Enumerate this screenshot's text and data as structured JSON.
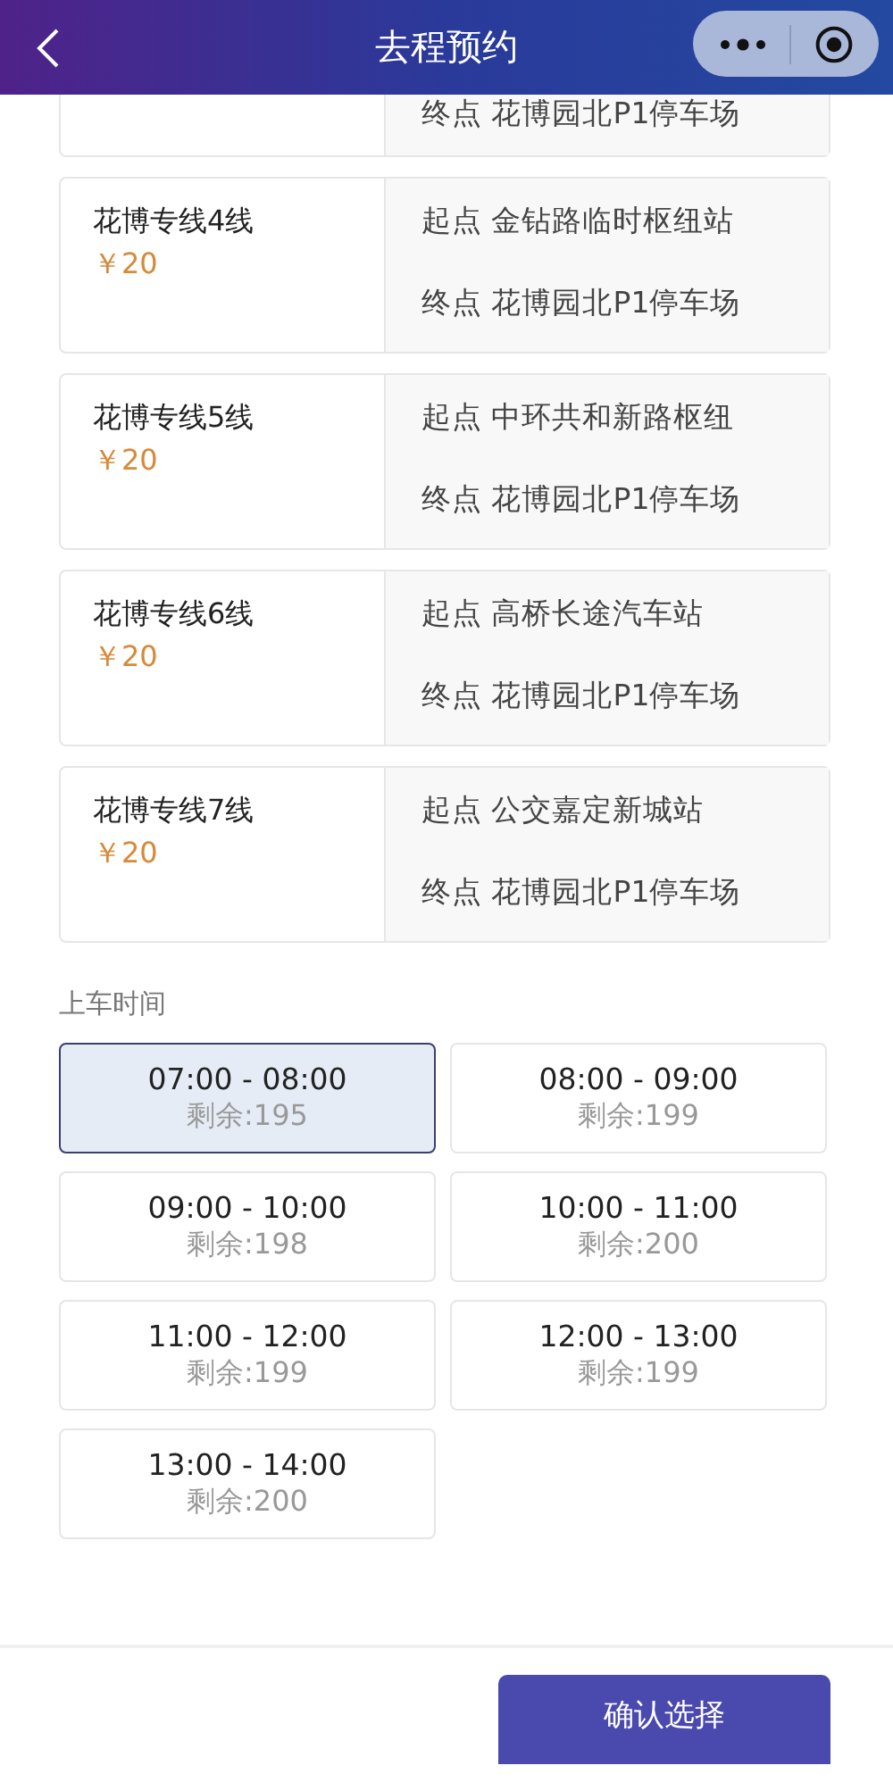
{
  "header": {
    "title": "去程预约"
  },
  "partial_route": {
    "end": "终点 花博园北P1停车场"
  },
  "routes": [
    {
      "name": "花博专线4线",
      "price": "￥20",
      "start": "起点 金钻路临时枢纽站",
      "end": "终点 花博园北P1停车场"
    },
    {
      "name": "花博专线5线",
      "price": "￥20",
      "start": "起点 中环共和新路枢纽",
      "end": "终点 花博园北P1停车场"
    },
    {
      "name": "花博专线6线",
      "price": "￥20",
      "start": "起点 高桥长途汽车站",
      "end": "终点 花博园北P1停车场"
    },
    {
      "name": "花博专线7线",
      "price": "￥20",
      "start": "起点 公交嘉定新城站",
      "end": "终点 花博园北P1停车场"
    }
  ],
  "time_section": {
    "label": "上车时间"
  },
  "time_slots": [
    {
      "time": "07:00 - 08:00",
      "remaining": "剩余:195",
      "selected": true
    },
    {
      "time": "08:00 - 09:00",
      "remaining": "剩余:199",
      "selected": false
    },
    {
      "time": "09:00 - 10:00",
      "remaining": "剩余:198",
      "selected": false
    },
    {
      "time": "10:00 - 11:00",
      "remaining": "剩余:200",
      "selected": false
    },
    {
      "time": "11:00 - 12:00",
      "remaining": "剩余:199",
      "selected": false
    },
    {
      "time": "12:00 - 13:00",
      "remaining": "剩余:199",
      "selected": false
    },
    {
      "time": "13:00 - 14:00",
      "remaining": "剩余:200",
      "selected": false
    }
  ],
  "confirm_button": "确认选择"
}
